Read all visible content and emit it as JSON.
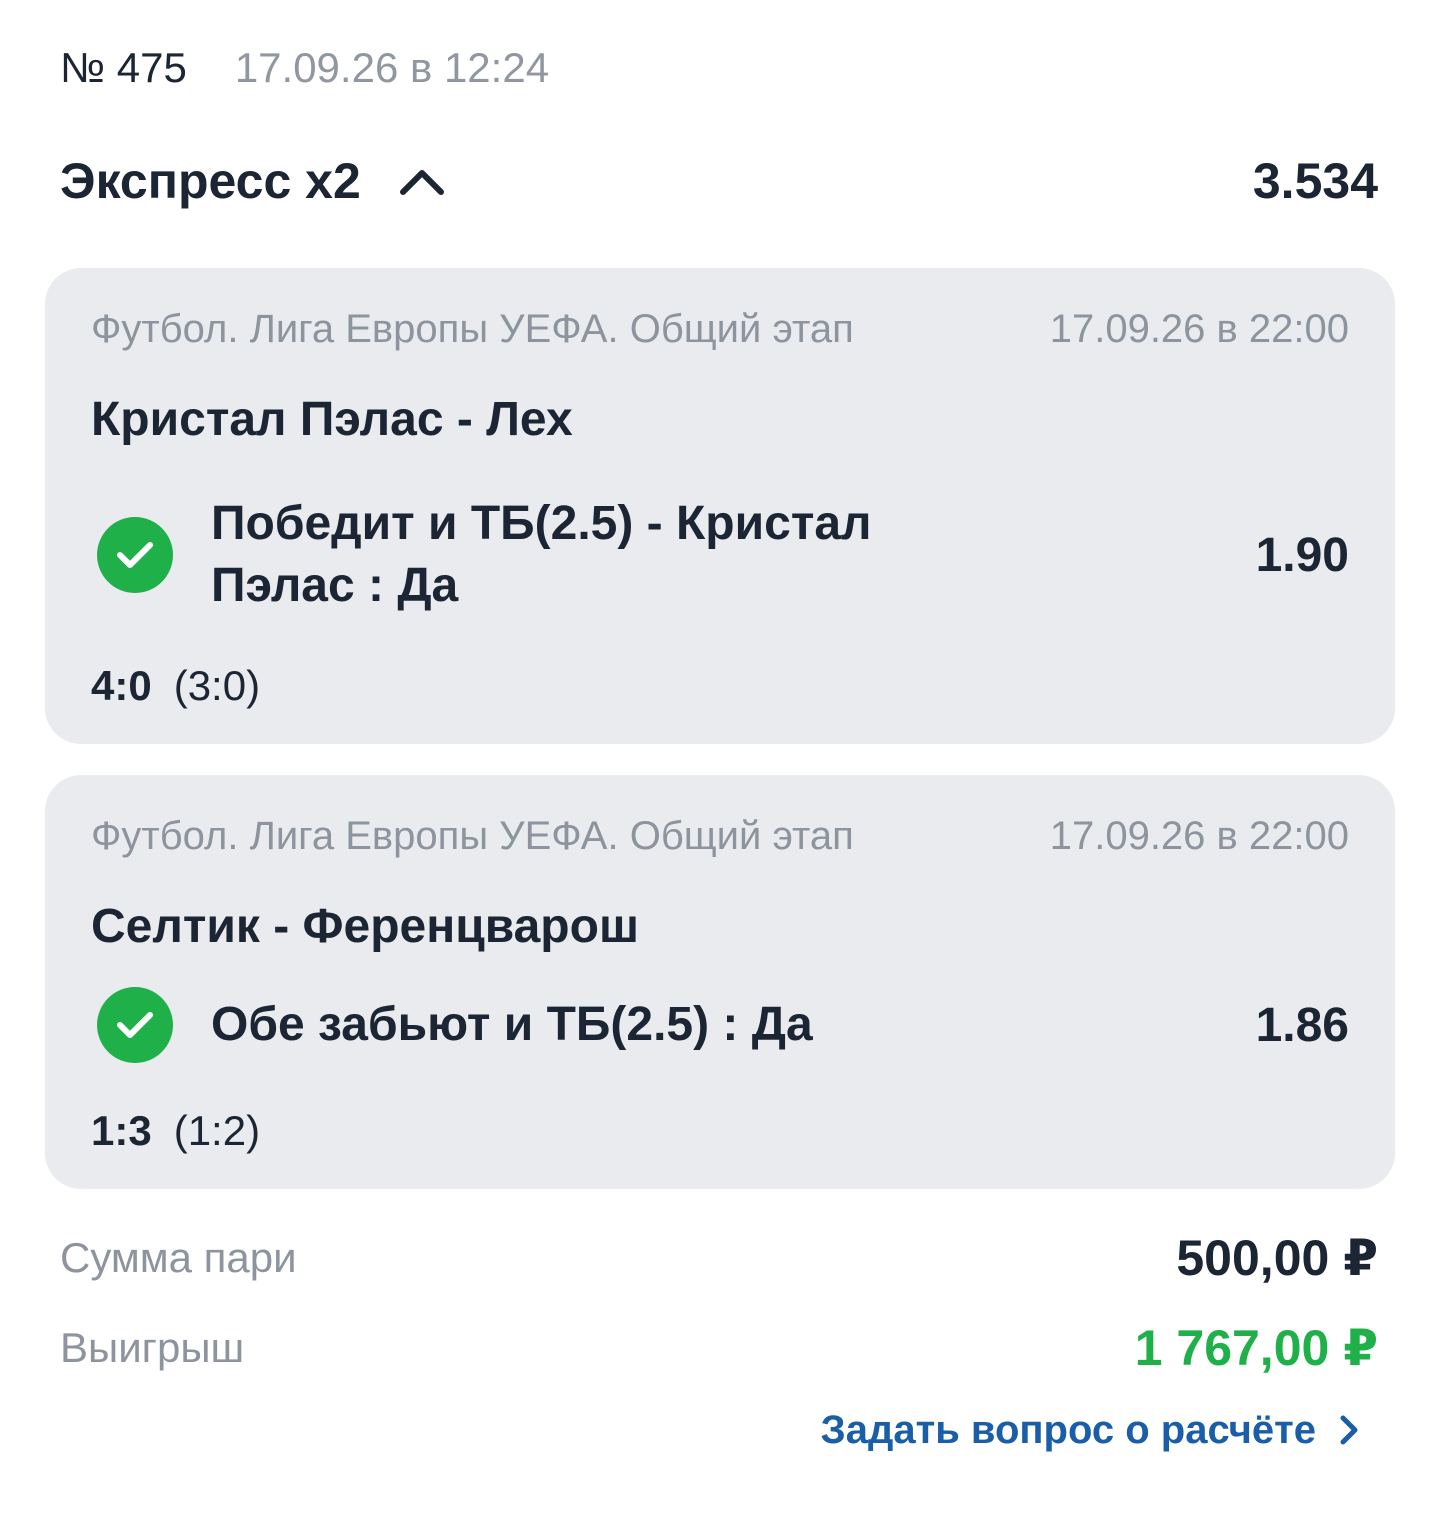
{
  "header": {
    "bet_number": "№ 475",
    "bet_date": "17.09.26 в 12:24"
  },
  "bet": {
    "type": "Экспресс х2",
    "total_odds": "3.534",
    "expanded": true
  },
  "events": [
    {
      "league": "Футбол. Лига Европы УЕФА. Общий этап",
      "datetime": "17.09.26 в 22:00",
      "match": "Кристал Пэлас - Лех",
      "outcome": "Победит и ТБ(2.5) - Кристал Пэлас : Да",
      "odds": "1.90",
      "status_icon": "check-circle-icon",
      "score": "4:0",
      "half_score": "(3:0)"
    },
    {
      "league": "Футбол. Лига Европы УЕФА. Общий этап",
      "datetime": "17.09.26 в 22:00",
      "match": "Селтик - Ференцварош",
      "outcome": "Обе забьют и ТБ(2.5) : Да",
      "odds": "1.86",
      "status_icon": "check-circle-icon",
      "score": "1:3",
      "half_score": "(1:2)"
    }
  ],
  "summary": {
    "stake_label": "Сумма пари",
    "stake_value": "500,00 ₽",
    "win_label": "Выигрыш",
    "win_value": "1 767,00 ₽"
  },
  "ask_link": {
    "label": "Задать вопрос о расчёте"
  },
  "colors": {
    "primary_text": "#1b2533",
    "secondary_text": "#8d949e",
    "card_bg": "#e9ebee",
    "win_green": "#1fb04a",
    "link_blue": "#1a5ea8"
  }
}
